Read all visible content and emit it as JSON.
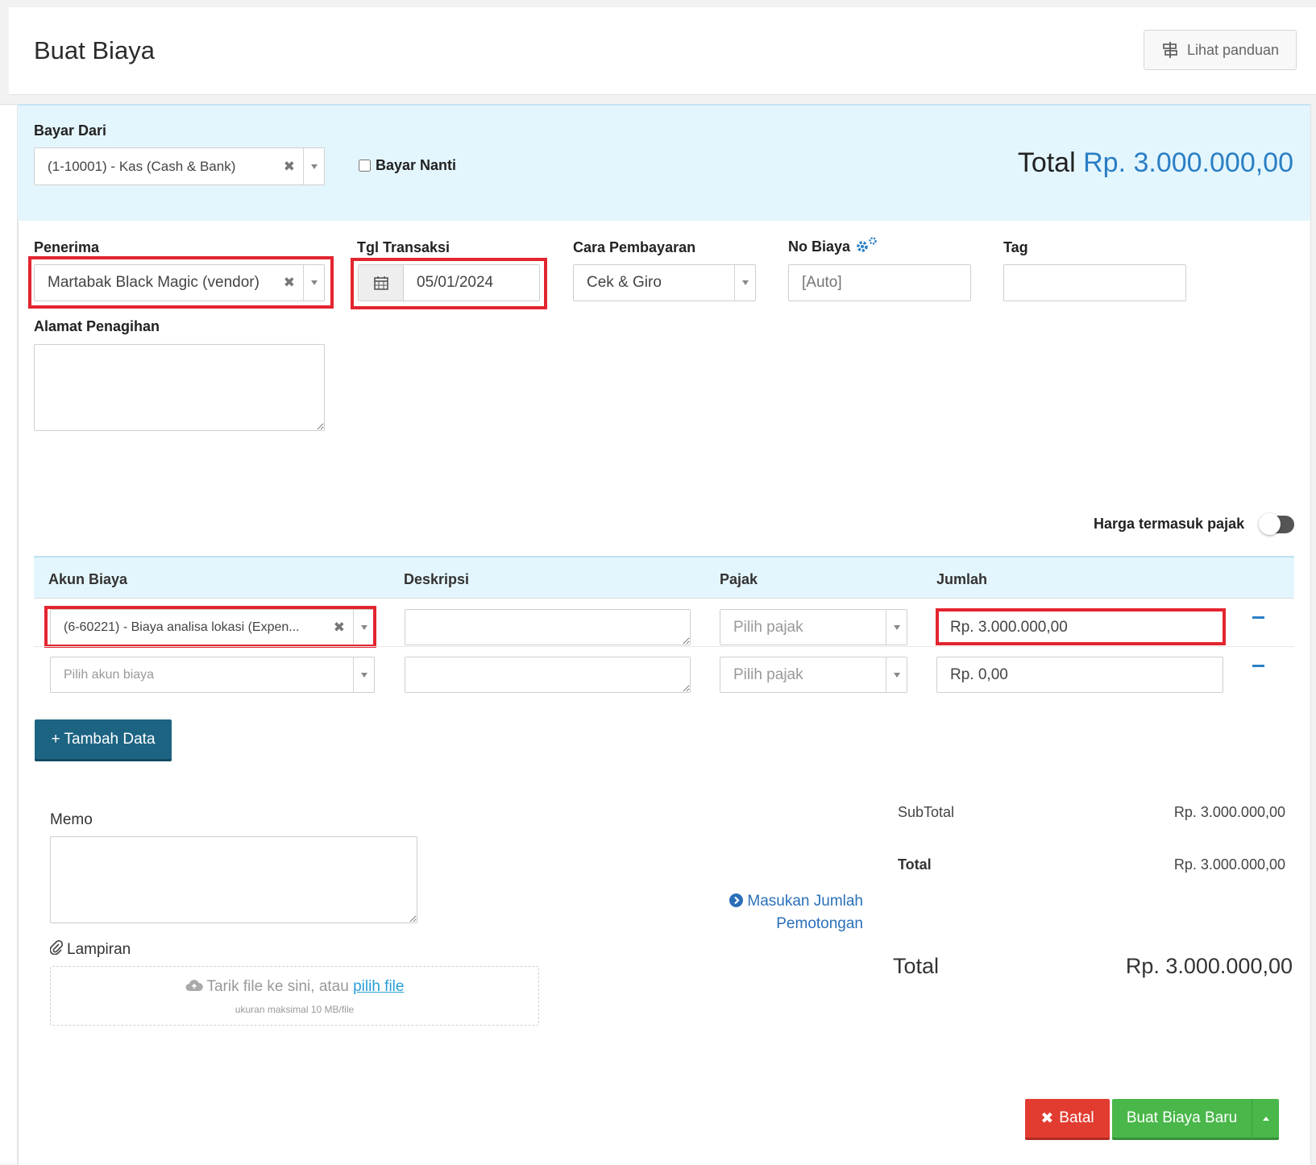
{
  "header": {
    "title": "Buat Biaya",
    "guide_label": "Lihat panduan"
  },
  "pay_from": {
    "label": "Bayar Dari",
    "value": "(1-10001) - Kas (Cash & Bank)",
    "pay_later_label": "Bayar Nanti"
  },
  "total_top": {
    "label": "Total",
    "value": "Rp. 3.000.000,00"
  },
  "form": {
    "recipient_label": "Penerima",
    "recipient_value": "Martabak Black Magic (vendor)",
    "date_label": "Tgl Transaksi",
    "date_value": "05/01/2024",
    "payment_method_label": "Cara Pembayaran",
    "payment_method_value": "Cek & Giro",
    "expense_no_label": "No Biaya",
    "expense_no_placeholder": "[Auto]",
    "tag_label": "Tag",
    "billing_address_label": "Alamat Penagihan"
  },
  "tax_inclusive_label": "Harga termasuk pajak",
  "table": {
    "headers": {
      "account": "Akun Biaya",
      "description": "Deskripsi",
      "tax": "Pajak",
      "amount": "Jumlah"
    },
    "rows": [
      {
        "account": "(6-60221) - Biaya analisa lokasi (Expen...",
        "tax_placeholder": "Pilih pajak",
        "amount": "Rp. 3.000.000,00"
      },
      {
        "account_placeholder": "Pilih akun biaya",
        "tax_placeholder": "Pilih pajak",
        "amount": "Rp. 0,00"
      }
    ],
    "add_button": "+ Tambah Data"
  },
  "memo_label": "Memo",
  "attachment": {
    "label": "Lampiran",
    "drop_text": "Tarik file ke sini, atau",
    "pick_link": "pilih file",
    "note": "ukuran maksimal 10 MB/file"
  },
  "summary": {
    "subtotal_label": "SubTotal",
    "subtotal_value": "Rp. 3.000.000,00",
    "total_label": "Total",
    "total_value": "Rp. 3.000.000,00",
    "deduction_link_line1": "Masukan Jumlah",
    "deduction_link_line2": "Pemotongan",
    "grand_total_label": "Total",
    "grand_total_value": "Rp. 3.000.000,00"
  },
  "actions": {
    "cancel": "Batal",
    "create": "Buat Biaya Baru"
  },
  "colors": {
    "accent_blue": "#2a7fc5",
    "highlight_red": "#e3252f",
    "band_bg": "#e4f6fd",
    "add_button": "#1d6483",
    "cancel_button": "#e23c31",
    "create_button": "#49b749"
  }
}
